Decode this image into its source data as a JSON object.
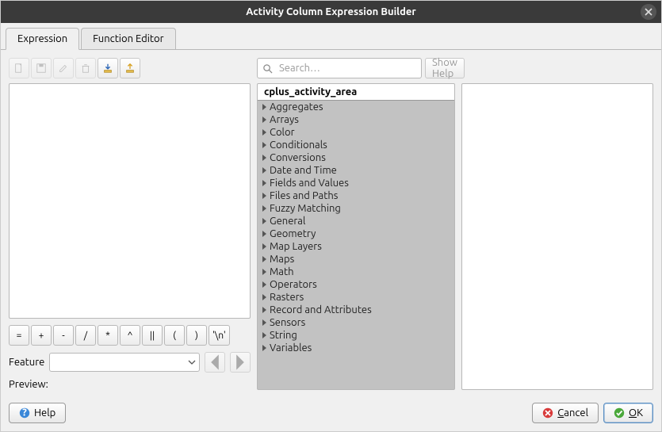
{
  "window": {
    "title": "Activity Column Expression Builder"
  },
  "tabs": [
    {
      "label": "Expression",
      "active": true
    },
    {
      "label": "Function Editor",
      "active": false
    }
  ],
  "left": {
    "operators": [
      "=",
      "+",
      "-",
      "/",
      "*",
      "^",
      "||",
      "(",
      ")",
      "'\\n'"
    ],
    "feature_label": "Feature",
    "preview_label": "Preview:"
  },
  "search": {
    "placeholder": "Search…",
    "show_help": "Show Help"
  },
  "tree": {
    "header": "cplus_activity_area",
    "items": [
      "Aggregates",
      "Arrays",
      "Color",
      "Conditionals",
      "Conversions",
      "Date and Time",
      "Fields and Values",
      "Files and Paths",
      "Fuzzy Matching",
      "General",
      "Geometry",
      "Map Layers",
      "Maps",
      "Math",
      "Operators",
      "Rasters",
      "Record and Attributes",
      "Sensors",
      "String",
      "Variables"
    ]
  },
  "footer": {
    "help": "Help",
    "cancel": "Cancel",
    "ok": "OK"
  }
}
